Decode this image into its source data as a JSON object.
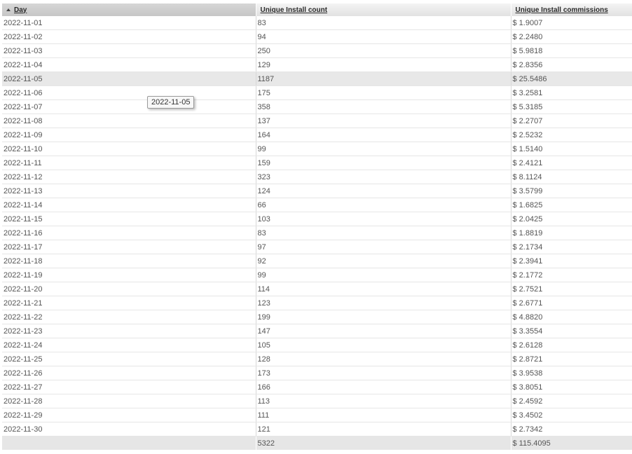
{
  "table": {
    "headers": {
      "day": "Day",
      "count": "Unique Install count",
      "commission": "Unique Install commissions"
    },
    "sorted_column": "day",
    "sort_direction": "ascending",
    "highlight_color": "#e8e8e8",
    "rows": [
      {
        "day": "2022-11-01",
        "count": "83",
        "commission": "$ 1.9007"
      },
      {
        "day": "2022-11-02",
        "count": "94",
        "commission": "$ 2.2480"
      },
      {
        "day": "2022-11-03",
        "count": "250",
        "commission": "$ 5.9818"
      },
      {
        "day": "2022-11-04",
        "count": "129",
        "commission": "$ 2.8356"
      },
      {
        "day": "2022-11-05",
        "count": "1187",
        "commission": "$ 25.5486",
        "highlighted": true
      },
      {
        "day": "2022-11-06",
        "count": "175",
        "commission": "$ 3.2581"
      },
      {
        "day": "2022-11-07",
        "count": "358",
        "commission": "$ 5.3185"
      },
      {
        "day": "2022-11-08",
        "count": "137",
        "commission": "$ 2.2707"
      },
      {
        "day": "2022-11-09",
        "count": "164",
        "commission": "$ 2.5232"
      },
      {
        "day": "2022-11-10",
        "count": "99",
        "commission": "$ 1.5140"
      },
      {
        "day": "2022-11-11",
        "count": "159",
        "commission": "$ 2.4121"
      },
      {
        "day": "2022-11-12",
        "count": "323",
        "commission": "$ 8.1124"
      },
      {
        "day": "2022-11-13",
        "count": "124",
        "commission": "$ 3.5799"
      },
      {
        "day": "2022-11-14",
        "count": "66",
        "commission": "$ 1.6825"
      },
      {
        "day": "2022-11-15",
        "count": "103",
        "commission": "$ 2.0425"
      },
      {
        "day": "2022-11-16",
        "count": "83",
        "commission": "$ 1.8819"
      },
      {
        "day": "2022-11-17",
        "count": "97",
        "commission": "$ 2.1734"
      },
      {
        "day": "2022-11-18",
        "count": "92",
        "commission": "$ 2.3941"
      },
      {
        "day": "2022-11-19",
        "count": "99",
        "commission": "$ 2.1772"
      },
      {
        "day": "2022-11-20",
        "count": "114",
        "commission": "$ 2.7521"
      },
      {
        "day": "2022-11-21",
        "count": "123",
        "commission": "$ 2.6771"
      },
      {
        "day": "2022-11-22",
        "count": "199",
        "commission": "$ 4.8820"
      },
      {
        "day": "2022-11-23",
        "count": "147",
        "commission": "$ 3.3554"
      },
      {
        "day": "2022-11-24",
        "count": "105",
        "commission": "$ 2.6128"
      },
      {
        "day": "2022-11-25",
        "count": "128",
        "commission": "$ 2.8721"
      },
      {
        "day": "2022-11-26",
        "count": "173",
        "commission": "$ 3.9538"
      },
      {
        "day": "2022-11-27",
        "count": "166",
        "commission": "$ 3.8051"
      },
      {
        "day": "2022-11-28",
        "count": "113",
        "commission": "$ 2.4592"
      },
      {
        "day": "2022-11-29",
        "count": "111",
        "commission": "$ 3.4502"
      },
      {
        "day": "2022-11-30",
        "count": "121",
        "commission": "$ 2.7342"
      }
    ],
    "totals": {
      "day": "",
      "count": "5322",
      "commission": "$ 115.4095"
    }
  },
  "tooltip": {
    "text": "2022-11-05"
  }
}
